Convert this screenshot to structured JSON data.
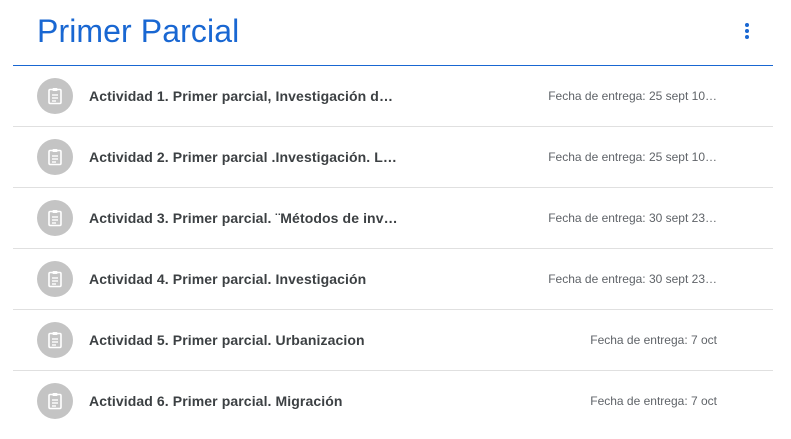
{
  "topic": {
    "title": "Primer Parcial",
    "more_icon": "more-vert-icon",
    "accent_color": "#1967d2"
  },
  "assignments": [
    {
      "title": "Actividad 1. Primer parcial, Investigación de…",
      "due": "Fecha de entrega: 25 sept 10…",
      "icon": "assignment-icon"
    },
    {
      "title": "Actividad 2. Primer parcial .Investigación. L…",
      "due": "Fecha de entrega: 25 sept 10…",
      "icon": "assignment-icon"
    },
    {
      "title": "Actividad 3. Primer parcial. ¨Métodos de inv…",
      "due": "Fecha de entrega: 30 sept 23…",
      "icon": "assignment-icon"
    },
    {
      "title": "Actividad 4. Primer parcial. Investigación",
      "due": "Fecha de entrega: 30 sept 23…",
      "icon": "assignment-icon"
    },
    {
      "title": "Actividad 5. Primer parcial. Urbanizacion",
      "due": "Fecha de entrega: 7 oct",
      "icon": "assignment-icon"
    },
    {
      "title": "Actividad 6. Primer parcial. Migración",
      "due": "Fecha de entrega: 7 oct",
      "icon": "assignment-icon"
    }
  ]
}
